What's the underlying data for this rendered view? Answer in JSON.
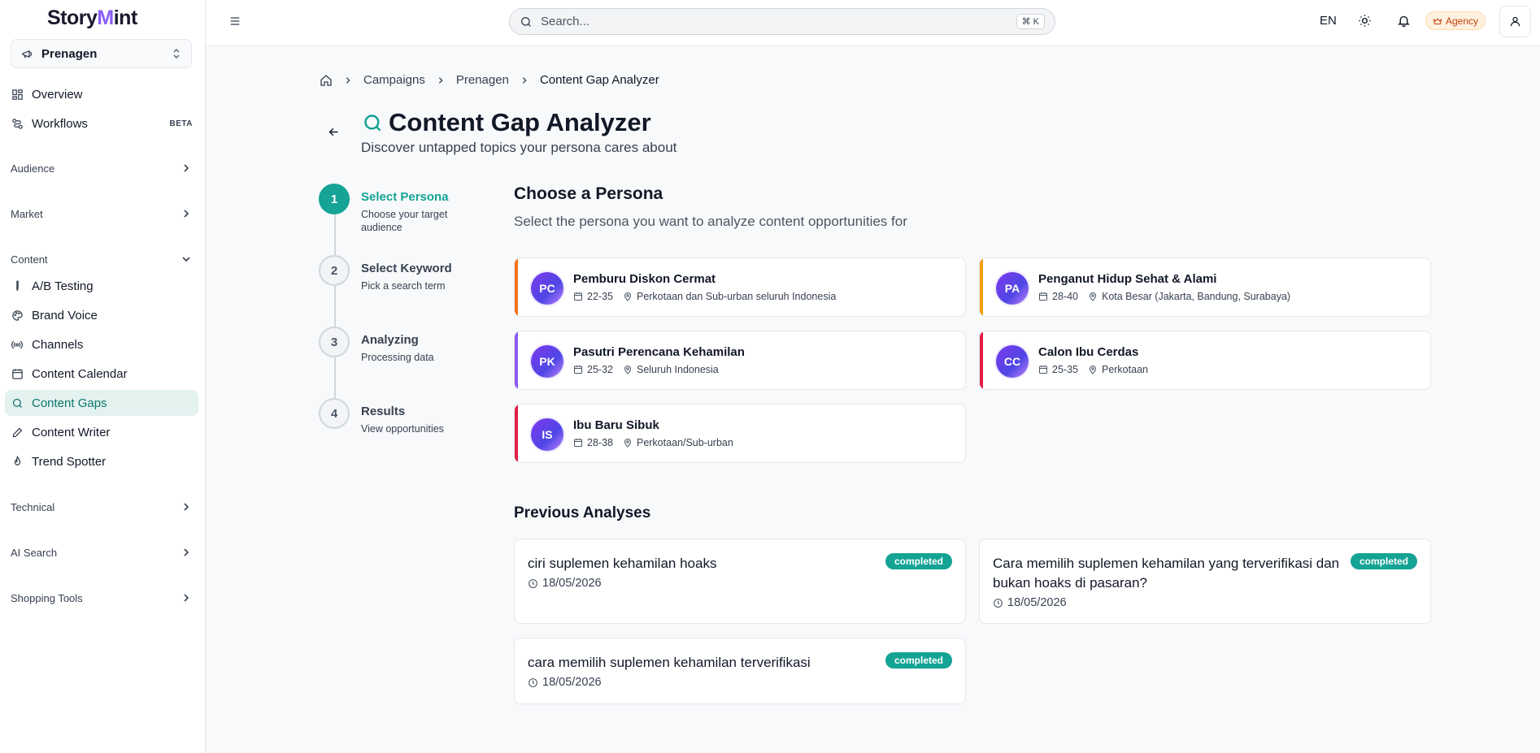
{
  "brand": {
    "logo_pre": "Story",
    "logo_m": "M",
    "logo_post": "int",
    "accent": "#14a394"
  },
  "sidebar": {
    "project": "Prenagen",
    "items": [
      {
        "label": "Overview",
        "icon": "grid-icon"
      },
      {
        "label": "Workflows",
        "icon": "workflow-icon",
        "badge": "BETA"
      }
    ],
    "sections": {
      "audience": "Audience",
      "market": "Market",
      "content": "Content",
      "technical": "Technical",
      "ai_search": "AI Search",
      "shopping_tools": "Shopping Tools"
    },
    "content_items": [
      {
        "label": "A/B Testing",
        "icon": "flask-icon"
      },
      {
        "label": "Brand Voice",
        "icon": "palette-icon"
      },
      {
        "label": "Channels",
        "icon": "broadcast-icon"
      },
      {
        "label": "Content Calendar",
        "icon": "calendar-icon"
      },
      {
        "label": "Content Gaps",
        "icon": "search-icon",
        "active": true
      },
      {
        "label": "Content Writer",
        "icon": "pen-icon"
      },
      {
        "label": "Trend Spotter",
        "icon": "flame-icon"
      }
    ]
  },
  "header": {
    "search_placeholder": "Search...",
    "shortcut": "⌘ K",
    "lang": "EN",
    "plan": "Agency"
  },
  "breadcrumb": {
    "campaigns": "Campaigns",
    "project": "Prenagen",
    "current": "Content Gap Analyzer"
  },
  "page": {
    "title": "Content Gap Analyzer",
    "subtitle": "Discover untapped topics your persona cares about"
  },
  "steps": [
    {
      "num": "1",
      "title": "Select Persona",
      "desc": "Choose your target audience"
    },
    {
      "num": "2",
      "title": "Select Keyword",
      "desc": "Pick a search term"
    },
    {
      "num": "3",
      "title": "Analyzing",
      "desc": "Processing data"
    },
    {
      "num": "4",
      "title": "Results",
      "desc": "View opportunities"
    }
  ],
  "persona_section": {
    "heading": "Choose a Persona",
    "description": "Select the persona you want to analyze content opportunities for"
  },
  "personas": [
    {
      "initials": "PC",
      "name": "Pemburu Diskon Cermat",
      "age": "22-35",
      "location": "Perkotaan dan Sub-urban seluruh Indonesia",
      "color": "#f97316"
    },
    {
      "initials": "PA",
      "name": "Penganut Hidup Sehat & Alami",
      "age": "28-40",
      "location": "Kota Besar (Jakarta, Bandung, Surabaya)",
      "color": "#f59e0b"
    },
    {
      "initials": "PK",
      "name": "Pasutri Perencana Kehamilan",
      "age": "25-32",
      "location": "Seluruh Indonesia",
      "color": "#8b5cf6"
    },
    {
      "initials": "CC",
      "name": "Calon Ibu Cerdas",
      "age": "25-35",
      "location": "Perkotaan",
      "color": "#e11d48"
    },
    {
      "initials": "IS",
      "name": "Ibu Baru Sibuk",
      "age": "28-38",
      "location": "Perkotaan/Sub-urban",
      "color": "#e11d48"
    }
  ],
  "previous": {
    "heading": "Previous Analyses",
    "items": [
      {
        "query": "ciri suplemen kehamilan hoaks",
        "date": "18/05/2026",
        "status": "completed"
      },
      {
        "query": "Cara memilih suplemen kehamilan yang terverifikasi dan bukan hoaks di pasaran?",
        "date": "18/05/2026",
        "status": "completed"
      },
      {
        "query": "cara memilih suplemen kehamilan terverifikasi",
        "date": "18/05/2026",
        "status": "completed"
      }
    ]
  }
}
